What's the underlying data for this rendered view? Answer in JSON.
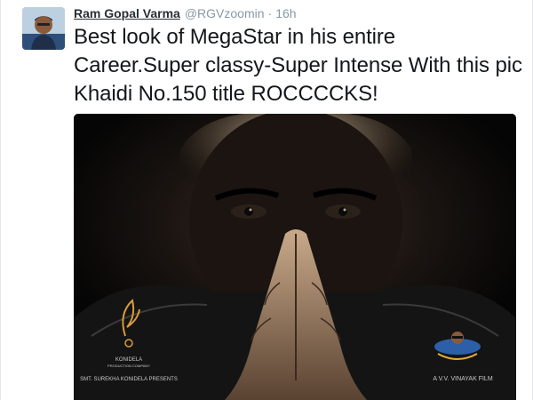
{
  "tweet": {
    "author_name": "Ram Gopal Varma",
    "handle": "@RGVzoomin",
    "separator": "·",
    "time": "16h",
    "text": "Best look of MegaStar in his entire Career.Super classy-Super Intense With this pic Khaidi No.150 title ROCCCCKS!"
  },
  "media": {
    "poster_studio_label": "KONIDELA",
    "poster_studio_sub": "PRODUCTION COMPANY",
    "poster_presents": "SMT. SUREKHA KONIDELA PRESENTS",
    "poster_director": "A V.V. VINAYAK FILM"
  },
  "colors": {
    "name": "#292f33",
    "meta": "#8899a6",
    "text": "#14171a",
    "poster_bg": "#0b0b0b",
    "poster_logo": "#d89a3a"
  }
}
